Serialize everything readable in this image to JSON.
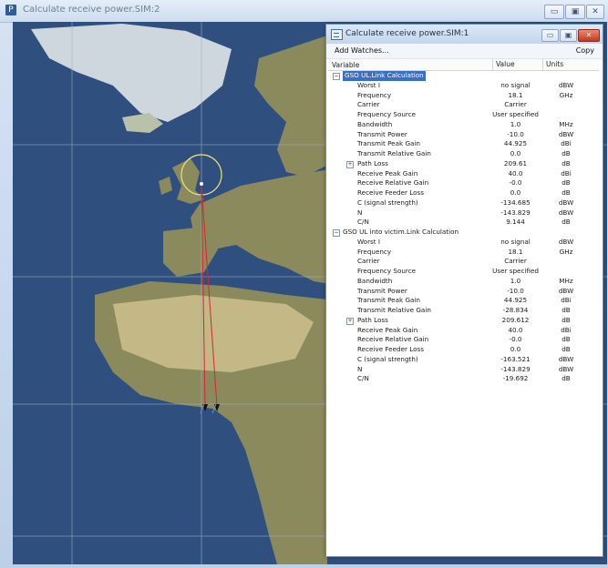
{
  "outer_window": {
    "title": "Calculate receive power.SIM:2",
    "app_icon": "P",
    "buttons": {
      "minimize": "▭",
      "maximize": "▣",
      "close": "✕"
    }
  },
  "inner_window": {
    "title": "Calculate receive power.SIM:1",
    "buttons": {
      "minimize": "▭",
      "maximize": "▣",
      "close": "✕"
    },
    "toolbar": {
      "add_watches": "Add Watches...",
      "copy": "Copy"
    },
    "columns": {
      "variable": "Variable",
      "value": "Value",
      "units": "Units"
    },
    "groups": [
      {
        "name": "GSO UL.Link Calculation",
        "selected": true,
        "rows": [
          {
            "label": "Worst I",
            "value": "no signal",
            "unit": "dBW"
          },
          {
            "label": "Frequency",
            "value": "18.1",
            "unit": "GHz"
          },
          {
            "label": "Carrier",
            "value": "Carrier",
            "unit": ""
          },
          {
            "label": "Frequency Source",
            "value": "User specified",
            "unit": ""
          },
          {
            "label": "Bandwidth",
            "value": "1.0",
            "unit": "MHz"
          },
          {
            "label": "Transmit Power",
            "value": "-10.0",
            "unit": "dBW"
          },
          {
            "label": "Transmit Peak Gain",
            "value": "44.925",
            "unit": "dBi"
          },
          {
            "label": "Transmit Relative Gain",
            "value": "0.0",
            "unit": "dB"
          },
          {
            "label": "Path Loss",
            "value": "209.61",
            "unit": "dB",
            "expandable": true
          },
          {
            "label": "Receive Peak Gain",
            "value": "40.0",
            "unit": "dBi"
          },
          {
            "label": "Receive Relative Gain",
            "value": "-0.0",
            "unit": "dB"
          },
          {
            "label": "Receive Feeder Loss",
            "value": "0.0",
            "unit": "dB"
          },
          {
            "label": "C (signal strength)",
            "value": "-134.685",
            "unit": "dBW"
          },
          {
            "label": "N",
            "value": "-143.829",
            "unit": "dBW"
          },
          {
            "label": "C/N",
            "value": "9.144",
            "unit": "dB"
          }
        ]
      },
      {
        "name": "GSO UL into victim.Link Calculation",
        "selected": false,
        "rows": [
          {
            "label": "Worst I",
            "value": "no signal",
            "unit": "dBW"
          },
          {
            "label": "Frequency",
            "value": "18.1",
            "unit": "GHz"
          },
          {
            "label": "Carrier",
            "value": "Carrier",
            "unit": ""
          },
          {
            "label": "Frequency Source",
            "value": "User specified",
            "unit": ""
          },
          {
            "label": "Bandwidth",
            "value": "1.0",
            "unit": "MHz"
          },
          {
            "label": "Transmit Power",
            "value": "-10.0",
            "unit": "dBW"
          },
          {
            "label": "Transmit Peak Gain",
            "value": "44.925",
            "unit": "dBi"
          },
          {
            "label": "Transmit Relative Gain",
            "value": "-28.834",
            "unit": "dB"
          },
          {
            "label": "Path Loss",
            "value": "209.612",
            "unit": "dB",
            "expandable": true
          },
          {
            "label": "Receive Peak Gain",
            "value": "40.0",
            "unit": "dBi"
          },
          {
            "label": "Receive Relative Gain",
            "value": "-0.0",
            "unit": "dB"
          },
          {
            "label": "Receive Feeder Loss",
            "value": "0.0",
            "unit": "dB"
          },
          {
            "label": "C (signal strength)",
            "value": "-163.521",
            "unit": "dBW"
          },
          {
            "label": "N",
            "value": "-143.829",
            "unit": "dBW"
          },
          {
            "label": "C/N",
            "value": "-19.692",
            "unit": "dB"
          }
        ]
      }
    ]
  },
  "map": {
    "ocean_color": "#2f507e",
    "land_color": "#8b8a5c",
    "link_line_color": "#d8262a",
    "beam_circle_color": "#e8e07a"
  }
}
